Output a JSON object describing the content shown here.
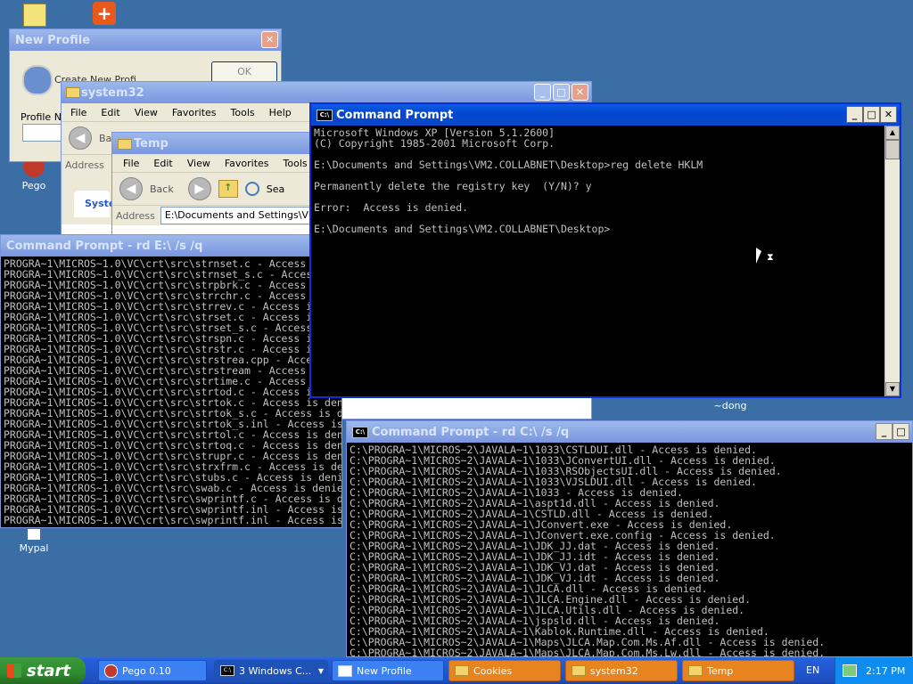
{
  "desktop": {
    "icons": [
      {
        "label": "Pego"
      },
      {
        "label": "Mypal"
      },
      {
        "label": "~dong"
      }
    ]
  },
  "new_profile": {
    "title": "New Profile",
    "ok_label": "OK",
    "text": "Create New Profi...",
    "profile_label": "Profile Na"
  },
  "system32": {
    "title": "system32",
    "menu": [
      "File",
      "Edit",
      "View",
      "Favorites",
      "Tools",
      "Help"
    ],
    "back_label": "Bac",
    "address_label": "Address",
    "task_label": "Syste"
  },
  "temp": {
    "title": "Temp",
    "menu": [
      "File",
      "Edit",
      "View",
      "Favorites",
      "Tools"
    ],
    "back_label": "Back",
    "search_label": "Sea",
    "address_label": "Address",
    "address_value": "E:\\Documents and Settings\\VM"
  },
  "cmd_main": {
    "title": "Command Prompt",
    "lines": [
      "Microsoft Windows XP [Version 5.1.2600]",
      "(C) Copyright 1985-2001 Microsoft Corp.",
      "",
      "E:\\Documents and Settings\\VM2.COLLABNET\\Desktop>reg delete HKLM",
      "",
      "Permanently delete the registry key  (Y/N)? y",
      "",
      "Error:  Access is denied.",
      "",
      "E:\\Documents and Settings\\VM2.COLLABNET\\Desktop>"
    ]
  },
  "cmd_e": {
    "title": "Command Prompt - rd E:\\ /s /q",
    "lines": [
      "PROGRA~1\\MICROS~1.0\\VC\\crt\\src\\strnset.c - Access is denied.",
      "PROGRA~1\\MICROS~1.0\\VC\\crt\\src\\strnset_s.c - Access is denied.",
      "PROGRA~1\\MICROS~1.0\\VC\\crt\\src\\strpbrk.c - Access is denied.",
      "PROGRA~1\\MICROS~1.0\\VC\\crt\\src\\strrchr.c - Access is denied.",
      "PROGRA~1\\MICROS~1.0\\VC\\crt\\src\\strrev.c - Access is denied.",
      "PROGRA~1\\MICROS~1.0\\VC\\crt\\src\\strset.c - Access is denied.",
      "PROGRA~1\\MICROS~1.0\\VC\\crt\\src\\strset_s.c - Access is denied.",
      "PROGRA~1\\MICROS~1.0\\VC\\crt\\src\\strspn.c - Access is denied.",
      "PROGRA~1\\MICROS~1.0\\VC\\crt\\src\\strstr.c - Access is denied.",
      "PROGRA~1\\MICROS~1.0\\VC\\crt\\src\\strstrea.cpp - Access is denied.",
      "PROGRA~1\\MICROS~1.0\\VC\\crt\\src\\strstream - Access is denied.",
      "PROGRA~1\\MICROS~1.0\\VC\\crt\\src\\strtime.c - Access is denied.",
      "PROGRA~1\\MICROS~1.0\\VC\\crt\\src\\strtod.c - Access is denied.",
      "PROGRA~1\\MICROS~1.0\\VC\\crt\\src\\strtok.c - Access is denied.",
      "PROGRA~1\\MICROS~1.0\\VC\\crt\\src\\strtok_s.c - Access is denied.",
      "PROGRA~1\\MICROS~1.0\\VC\\crt\\src\\strtok_s.inl - Access is denied.",
      "PROGRA~1\\MICROS~1.0\\VC\\crt\\src\\strtol.c - Access is denied.",
      "PROGRA~1\\MICROS~1.0\\VC\\crt\\src\\strtoq.c - Access is denied.",
      "PROGRA~1\\MICROS~1.0\\VC\\crt\\src\\strupr.c - Access is denied.",
      "PROGRA~1\\MICROS~1.0\\VC\\crt\\src\\strxfrm.c - Access is denied.",
      "PROGRA~1\\MICROS~1.0\\VC\\crt\\src\\stubs.c - Access is denied.",
      "PROGRA~1\\MICROS~1.0\\VC\\crt\\src\\swab.c - Access is denied.",
      "PROGRA~1\\MICROS~1.0\\VC\\crt\\src\\swprintf.c - Access is denied.",
      "PROGRA~1\\MICROS~1.0\\VC\\crt\\src\\swprintf.inl - Access is denied.",
      "PROGRA~1\\MICROS~1.0\\VC\\crt\\src\\swprintf.inl - Access is denied."
    ]
  },
  "cmd_c": {
    "title": "Command Prompt - rd C:\\ /s /q",
    "lines": [
      "C:\\PROGRA~1\\MICROS~2\\JAVALA~1\\1033\\CSTLDUI.dll - Access is denied.",
      "C:\\PROGRA~1\\MICROS~2\\JAVALA~1\\1033\\JConvertUI.dll - Access is denied.",
      "C:\\PROGRA~1\\MICROS~2\\JAVALA~1\\1033\\RSObjectsUI.dll - Access is denied.",
      "C:\\PROGRA~1\\MICROS~2\\JAVALA~1\\1033\\VJSLDUI.dll - Access is denied.",
      "C:\\PROGRA~1\\MICROS~2\\JAVALA~1\\1033 - Access is denied.",
      "C:\\PROGRA~1\\MICROS~2\\JAVALA~1\\aspt1d.dll - Access is denied.",
      "C:\\PROGRA~1\\MICROS~2\\JAVALA~1\\CSTLD.dll - Access is denied.",
      "C:\\PROGRA~1\\MICROS~2\\JAVALA~1\\JConvert.exe - Access is denied.",
      "C:\\PROGRA~1\\MICROS~2\\JAVALA~1\\JConvert.exe.config - Access is denied.",
      "C:\\PROGRA~1\\MICROS~2\\JAVALA~1\\JDK_JJ.dat - Access is denied.",
      "C:\\PROGRA~1\\MICROS~2\\JAVALA~1\\JDK_JJ.idt - Access is denied.",
      "C:\\PROGRA~1\\MICROS~2\\JAVALA~1\\JDK_VJ.dat - Access is denied.",
      "C:\\PROGRA~1\\MICROS~2\\JAVALA~1\\JDK_VJ.idt - Access is denied.",
      "C:\\PROGRA~1\\MICROS~2\\JAVALA~1\\JLCA.dll - Access is denied.",
      "C:\\PROGRA~1\\MICROS~2\\JAVALA~1\\JLCA.Engine.dll - Access is denied.",
      "C:\\PROGRA~1\\MICROS~2\\JAVALA~1\\JLCA.Utils.dll - Access is denied.",
      "C:\\PROGRA~1\\MICROS~2\\JAVALA~1\\jspsld.dll - Access is denied.",
      "C:\\PROGRA~1\\MICROS~2\\JAVALA~1\\Kablok.Runtime.dll - Access is denied.",
      "C:\\PROGRA~1\\MICROS~2\\JAVALA~1\\Maps\\JLCA.Map.Com.Ms.Af.dll - Access is denied.",
      "C:\\PROGRA~1\\MICROS~2\\JAVALA~1\\Maps\\JLCA.Map.Com.Ms.Lw.dll - Access is denied."
    ]
  },
  "taskbar": {
    "start_label": "start",
    "items": [
      {
        "label": "Pego 0.10"
      },
      {
        "label": "3 Windows C..."
      },
      {
        "label": "New Profile"
      },
      {
        "label": "Cookies"
      },
      {
        "label": "system32"
      },
      {
        "label": "Temp"
      }
    ],
    "language": "EN",
    "clock": "2:17 PM"
  },
  "icons": {
    "console": "console-icon",
    "folder": "folder-icon",
    "minimize": "minimize-icon",
    "maximize": "maximize-icon",
    "close": "close-icon"
  }
}
